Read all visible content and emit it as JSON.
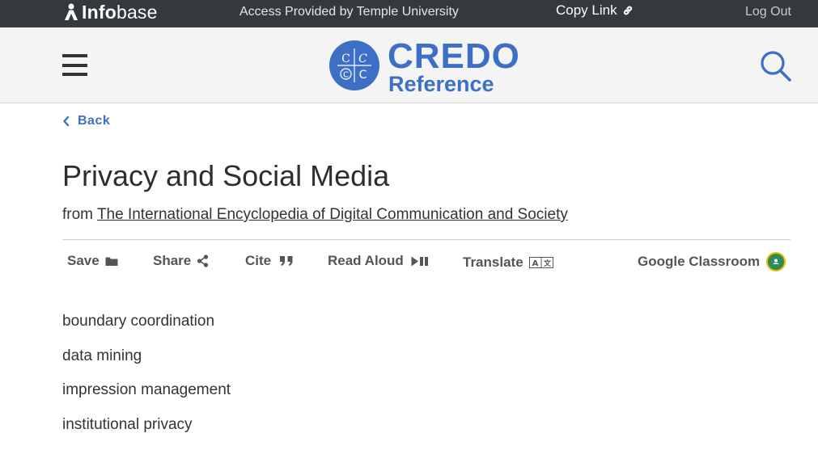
{
  "topbar": {
    "logo_prefix": "Info",
    "logo_suffix": "base",
    "access_text": "Access Provided by Temple University",
    "copy_link": "Copy Link",
    "logout": "Log Out"
  },
  "header": {
    "brand_main": "CREDO",
    "brand_sub": "Reference"
  },
  "nav": {
    "back": "Back"
  },
  "article": {
    "title": "Privacy and Social Media",
    "from_prefix": "from",
    "source": "The International Encyclopedia of Digital Communication and Society"
  },
  "toolbar": {
    "save": "Save",
    "share": "Share",
    "cite": "Cite",
    "read_aloud": "Read Aloud",
    "translate": "Translate",
    "google_classroom": "Google Classroom"
  },
  "terms": [
    "boundary coordination",
    "data mining",
    "impression management",
    "institutional privacy"
  ],
  "colors": {
    "topbar_bg": "#34393e",
    "accent_blue": "#3d6fc4",
    "classroom_green": "#2e8b57"
  }
}
